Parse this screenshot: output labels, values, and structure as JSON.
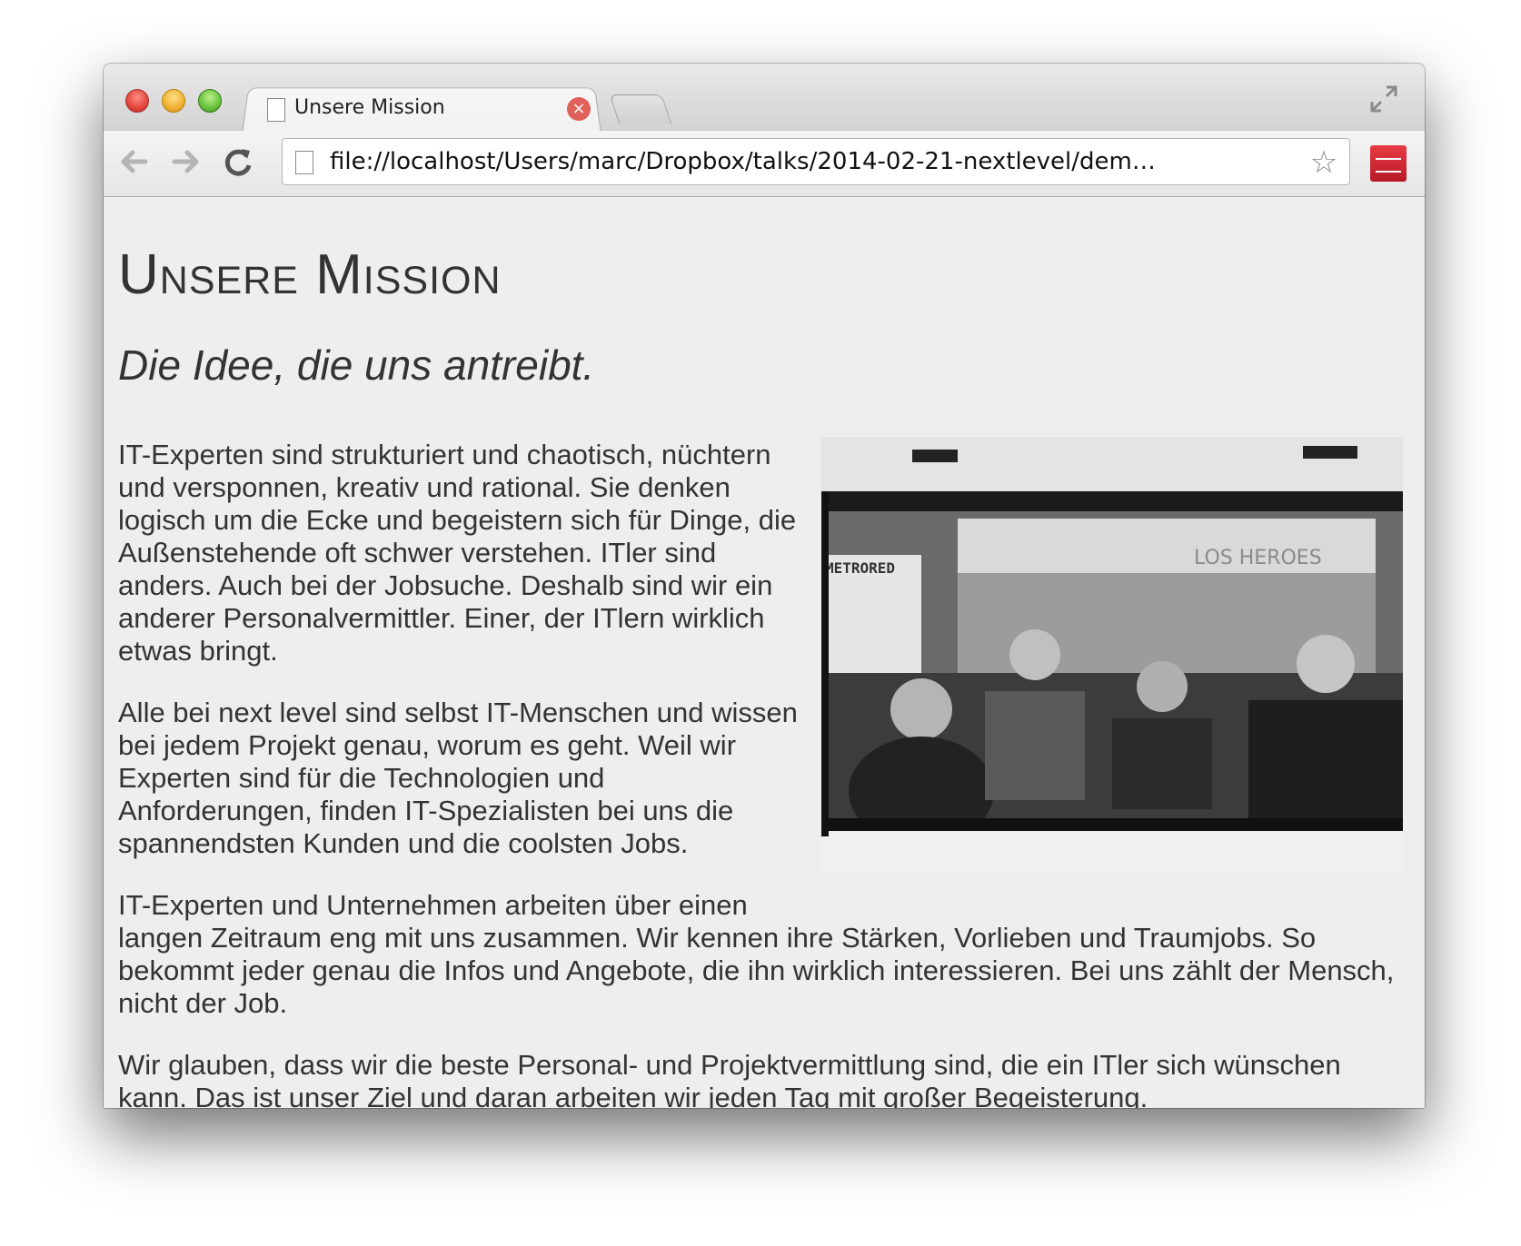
{
  "tab": {
    "title": "Unsere Mission"
  },
  "toolbar": {
    "url": "file://localhost/Users/marc/Dropbox/talks/2014-02-21-nextlevel/dem…"
  },
  "page": {
    "title": "Unsere Mission",
    "subtitle": "Die Idee, die uns antreibt.",
    "paragraphs": [
      "IT-Experten sind strukturiert und chaotisch, nüchtern und versponnen, kreativ und rational. Sie denken logisch um die Ecke und begeistern sich für Dinge, die Außenstehende oft schwer verstehen. ITler sind anders. Auch bei der Jobsuche. Deshalb sind wir ein anderer Personalvermittler. Einer, der ITlern wirklich etwas bringt.",
      "Alle bei next level sind selbst IT-Menschen und wissen bei jedem Projekt genau, worum es geht. Weil wir Experten sind für die Technologien und Anforderungen, finden IT-Spezialisten bei uns die spannendsten Kunden und die coolsten Jobs.",
      "Wir glauben, dass wir die beste Personal- und Projektvermittlung sind, die ein ITler sich wünschen kann. Das ist unser Ziel und daran arbeiten wir jeden Tag mit großer Begeisterung."
    ],
    "paragraph3_first": "IT-Experten und Unternehmen arbeiten über einen",
    "paragraph3_rest": "langen Zeitraum eng mit uns zusammen. Wir kennen ihre Stärken, Vorlieben und Traumjobs. So bekommt jeder genau die Infos und Angebote, die ihn wirklich interessieren. Bei uns zählt der Mensch, nicht der Job.",
    "photo_sign_left": "METRORED",
    "photo_sign_right": "LOS HEROES"
  },
  "colors": {
    "page_bg": "#eeeeee",
    "text": "#333333",
    "close_red": "#e0605a",
    "menu_orange": "#f29a1a"
  },
  "icons": [
    "file-icon",
    "close-icon",
    "back-arrow-icon",
    "forward-arrow-icon",
    "reload-icon",
    "star-icon",
    "extension-icon",
    "menu-icon",
    "fullscreen-icon"
  ]
}
